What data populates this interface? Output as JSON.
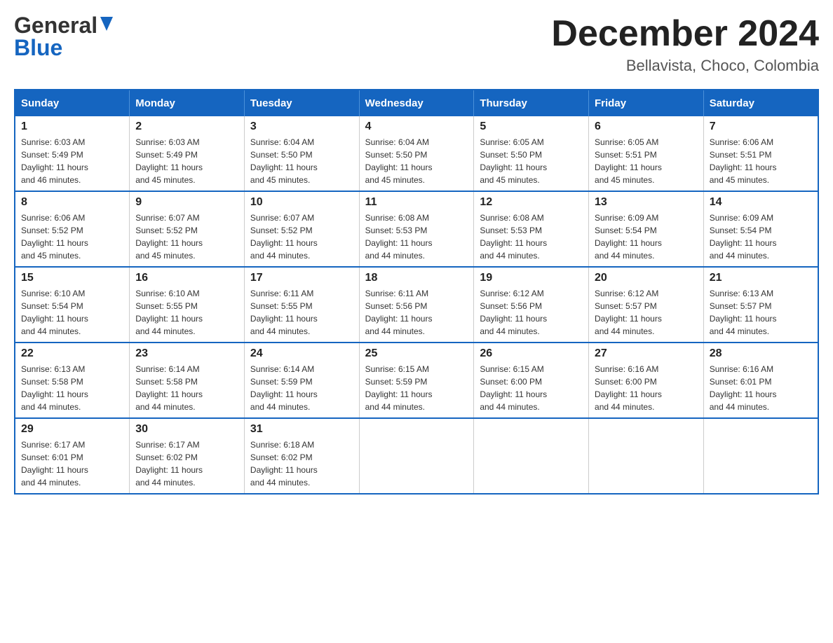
{
  "header": {
    "logo_general": "General",
    "logo_blue": "Blue",
    "month_title": "December 2024",
    "location": "Bellavista, Choco, Colombia"
  },
  "days_of_week": [
    "Sunday",
    "Monday",
    "Tuesday",
    "Wednesday",
    "Thursday",
    "Friday",
    "Saturday"
  ],
  "weeks": [
    [
      {
        "day": "1",
        "sunrise": "6:03 AM",
        "sunset": "5:49 PM",
        "daylight": "11 hours and 46 minutes."
      },
      {
        "day": "2",
        "sunrise": "6:03 AM",
        "sunset": "5:49 PM",
        "daylight": "11 hours and 45 minutes."
      },
      {
        "day": "3",
        "sunrise": "6:04 AM",
        "sunset": "5:50 PM",
        "daylight": "11 hours and 45 minutes."
      },
      {
        "day": "4",
        "sunrise": "6:04 AM",
        "sunset": "5:50 PM",
        "daylight": "11 hours and 45 minutes."
      },
      {
        "day": "5",
        "sunrise": "6:05 AM",
        "sunset": "5:50 PM",
        "daylight": "11 hours and 45 minutes."
      },
      {
        "day": "6",
        "sunrise": "6:05 AM",
        "sunset": "5:51 PM",
        "daylight": "11 hours and 45 minutes."
      },
      {
        "day": "7",
        "sunrise": "6:06 AM",
        "sunset": "5:51 PM",
        "daylight": "11 hours and 45 minutes."
      }
    ],
    [
      {
        "day": "8",
        "sunrise": "6:06 AM",
        "sunset": "5:52 PM",
        "daylight": "11 hours and 45 minutes."
      },
      {
        "day": "9",
        "sunrise": "6:07 AM",
        "sunset": "5:52 PM",
        "daylight": "11 hours and 45 minutes."
      },
      {
        "day": "10",
        "sunrise": "6:07 AM",
        "sunset": "5:52 PM",
        "daylight": "11 hours and 44 minutes."
      },
      {
        "day": "11",
        "sunrise": "6:08 AM",
        "sunset": "5:53 PM",
        "daylight": "11 hours and 44 minutes."
      },
      {
        "day": "12",
        "sunrise": "6:08 AM",
        "sunset": "5:53 PM",
        "daylight": "11 hours and 44 minutes."
      },
      {
        "day": "13",
        "sunrise": "6:09 AM",
        "sunset": "5:54 PM",
        "daylight": "11 hours and 44 minutes."
      },
      {
        "day": "14",
        "sunrise": "6:09 AM",
        "sunset": "5:54 PM",
        "daylight": "11 hours and 44 minutes."
      }
    ],
    [
      {
        "day": "15",
        "sunrise": "6:10 AM",
        "sunset": "5:54 PM",
        "daylight": "11 hours and 44 minutes."
      },
      {
        "day": "16",
        "sunrise": "6:10 AM",
        "sunset": "5:55 PM",
        "daylight": "11 hours and 44 minutes."
      },
      {
        "day": "17",
        "sunrise": "6:11 AM",
        "sunset": "5:55 PM",
        "daylight": "11 hours and 44 minutes."
      },
      {
        "day": "18",
        "sunrise": "6:11 AM",
        "sunset": "5:56 PM",
        "daylight": "11 hours and 44 minutes."
      },
      {
        "day": "19",
        "sunrise": "6:12 AM",
        "sunset": "5:56 PM",
        "daylight": "11 hours and 44 minutes."
      },
      {
        "day": "20",
        "sunrise": "6:12 AM",
        "sunset": "5:57 PM",
        "daylight": "11 hours and 44 minutes."
      },
      {
        "day": "21",
        "sunrise": "6:13 AM",
        "sunset": "5:57 PM",
        "daylight": "11 hours and 44 minutes."
      }
    ],
    [
      {
        "day": "22",
        "sunrise": "6:13 AM",
        "sunset": "5:58 PM",
        "daylight": "11 hours and 44 minutes."
      },
      {
        "day": "23",
        "sunrise": "6:14 AM",
        "sunset": "5:58 PM",
        "daylight": "11 hours and 44 minutes."
      },
      {
        "day": "24",
        "sunrise": "6:14 AM",
        "sunset": "5:59 PM",
        "daylight": "11 hours and 44 minutes."
      },
      {
        "day": "25",
        "sunrise": "6:15 AM",
        "sunset": "5:59 PM",
        "daylight": "11 hours and 44 minutes."
      },
      {
        "day": "26",
        "sunrise": "6:15 AM",
        "sunset": "6:00 PM",
        "daylight": "11 hours and 44 minutes."
      },
      {
        "day": "27",
        "sunrise": "6:16 AM",
        "sunset": "6:00 PM",
        "daylight": "11 hours and 44 minutes."
      },
      {
        "day": "28",
        "sunrise": "6:16 AM",
        "sunset": "6:01 PM",
        "daylight": "11 hours and 44 minutes."
      }
    ],
    [
      {
        "day": "29",
        "sunrise": "6:17 AM",
        "sunset": "6:01 PM",
        "daylight": "11 hours and 44 minutes."
      },
      {
        "day": "30",
        "sunrise": "6:17 AM",
        "sunset": "6:02 PM",
        "daylight": "11 hours and 44 minutes."
      },
      {
        "day": "31",
        "sunrise": "6:18 AM",
        "sunset": "6:02 PM",
        "daylight": "11 hours and 44 minutes."
      },
      null,
      null,
      null,
      null
    ]
  ],
  "labels": {
    "sunrise": "Sunrise:",
    "sunset": "Sunset:",
    "daylight": "Daylight:"
  }
}
